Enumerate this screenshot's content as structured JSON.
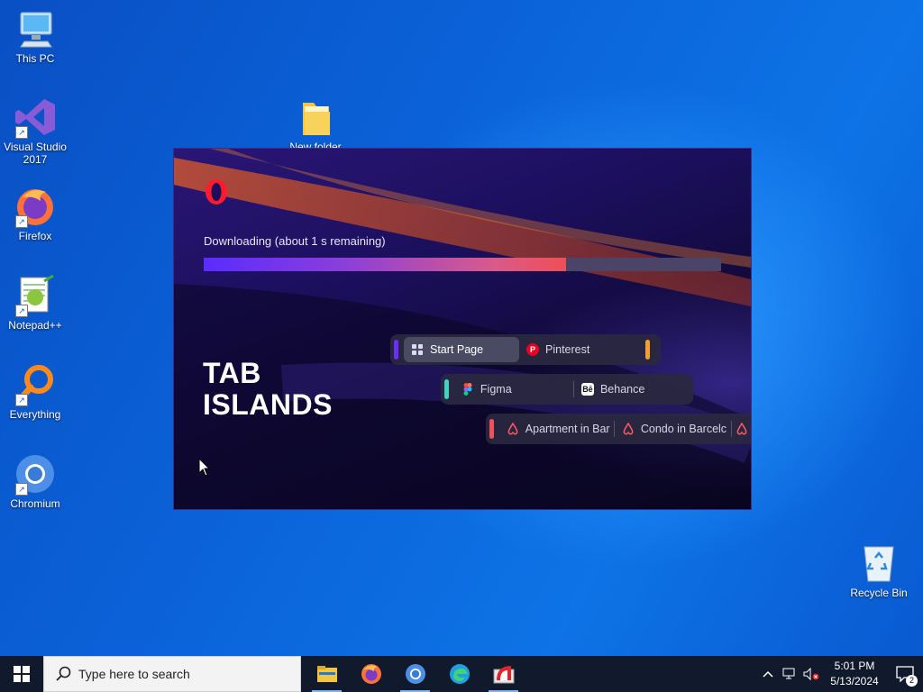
{
  "desktop": {
    "icons": [
      {
        "label": "This PC",
        "icon": "computer-icon"
      },
      {
        "label": "Visual Studio\n2017",
        "icon": "visual-studio-icon"
      },
      {
        "label": "Firefox",
        "icon": "firefox-icon"
      },
      {
        "label": "Notepad++",
        "icon": "notepadpp-icon"
      },
      {
        "label": "Everything",
        "icon": "everything-icon"
      },
      {
        "label": "Chromium",
        "icon": "chromium-icon"
      },
      {
        "label": "New folder",
        "icon": "folder-icon"
      },
      {
        "label": "Recycle Bin",
        "icon": "recycle-bin-icon"
      }
    ]
  },
  "installer": {
    "status_text": "Downloading (about 1 s remaining)",
    "progress": 0.7,
    "headline_line1": "TAB",
    "headline_line2": "ISLANDS",
    "islands": [
      {
        "color": "#6a2cff",
        "end_color": "#f0a030",
        "tabs": [
          {
            "label": "Start Page",
            "icon": "grid-icon"
          },
          {
            "label": "Pinterest",
            "icon": "pinterest-icon"
          }
        ]
      },
      {
        "color": "#3fd3c4",
        "tabs": [
          {
            "label": "Figma",
            "icon": "figma-icon"
          },
          {
            "label": "Behance",
            "icon": "behance-icon"
          }
        ]
      },
      {
        "color": "#f0505a",
        "tabs": [
          {
            "label": "Apartment in Bar",
            "icon": "airbnb-icon"
          },
          {
            "label": "Condo in Barcelc",
            "icon": "airbnb-icon"
          }
        ]
      }
    ]
  },
  "taskbar": {
    "search_placeholder": "Type here to search",
    "apps": [
      "file-explorer-icon",
      "firefox-icon",
      "chromium-icon",
      "edge-icon",
      "opera-installer-icon"
    ],
    "time": "5:01 PM",
    "date": "5/13/2024",
    "notification_count": "2"
  }
}
